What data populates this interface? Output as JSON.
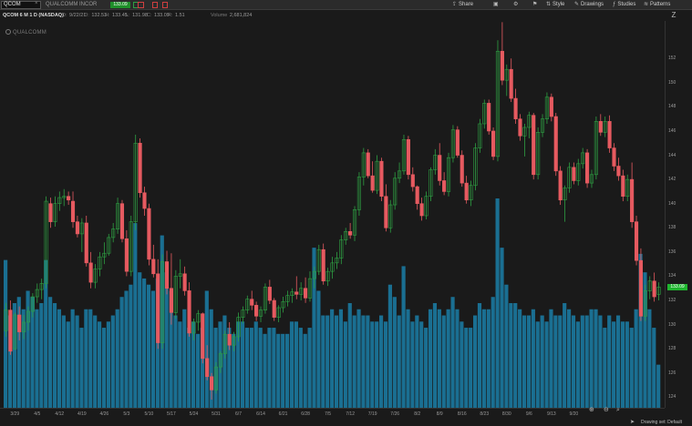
{
  "toolbar": {
    "symbol": "QCOM",
    "close_glyph": "×",
    "company": "QUALCOMM INCOR",
    "price": "133.09",
    "buttons": [
      {
        "label": "Share",
        "icon": "share-icon",
        "glyph": "⇪"
      },
      {
        "label": "",
        "icon": "layout-icon",
        "glyph": "▣"
      },
      {
        "label": "",
        "icon": "settings-icon",
        "glyph": "⚙"
      },
      {
        "label": "",
        "icon": "flag-icon",
        "glyph": "⚑"
      },
      {
        "label": "Style",
        "icon": "style-icon",
        "glyph": "⇅"
      },
      {
        "label": "Drawings",
        "icon": "drawings-icon",
        "glyph": "✎"
      },
      {
        "label": "Studies",
        "icon": "studies-icon",
        "glyph": "ƒ"
      },
      {
        "label": "Patterns",
        "icon": "patterns-icon",
        "glyph": "≋"
      }
    ]
  },
  "ohlc": {
    "title": "QCOM 6 M 1 D (NASDAQ)",
    "items": [
      {
        "k": "D:",
        "v": "9/22/21"
      },
      {
        "k": "O:",
        "v": "132.53"
      },
      {
        "k": "H:",
        "v": "133.45"
      },
      {
        "k": "L:",
        "v": "131.98"
      },
      {
        "k": "C:",
        "v": "133.09"
      },
      {
        "k": "R:",
        "v": "1.51"
      },
      {
        "k": "Volume",
        "v": "2,681,824"
      }
    ]
  },
  "watermark": "QUALCOMM",
  "axis_icon": "Z",
  "status": "Drawing set: Default",
  "chart_data": {
    "type": "candlestick+volume",
    "y_min": 123,
    "y_max": 143,
    "y_ticks": [
      124,
      126,
      128,
      130,
      132,
      134,
      136,
      138,
      140,
      142,
      144,
      146,
      148,
      150,
      152
    ],
    "last_price": 133.09,
    "x_ticks": [
      "3/29",
      "4/5",
      "4/12",
      "4/19",
      "4/26",
      "5/3",
      "5/10",
      "5/17",
      "5/24",
      "5/31",
      "6/7",
      "6/14",
      "6/21",
      "6/28",
      "7/5",
      "7/12",
      "7/19",
      "7/26",
      "8/2",
      "8/9",
      "8/16",
      "8/23",
      "8/30",
      "9/6",
      "9/13",
      "9/20"
    ],
    "colors": {
      "up": "#2ea043",
      "down": "#e65a60",
      "volume": "#1a6f92"
    },
    "candles": [
      [
        129.5,
        131.8,
        129.0,
        131.2,
        2.4
      ],
      [
        131.2,
        132.0,
        127.5,
        127.8,
        1.5
      ],
      [
        128.0,
        131.0,
        127.9,
        130.8,
        1.7
      ],
      [
        130.8,
        131.5,
        128.7,
        129.4,
        1.8
      ],
      [
        129.4,
        130.8,
        128.8,
        130.2,
        1.6
      ],
      [
        130.2,
        131.5,
        129.5,
        131.1,
        1.9
      ],
      [
        131.1,
        132.6,
        130.6,
        132.3,
        1.8
      ],
      [
        132.3,
        133.4,
        131.8,
        132.9,
        1.6
      ],
      [
        132.9,
        133.8,
        132.1,
        133.4,
        1.7
      ],
      [
        133.4,
        140.6,
        133.0,
        140.2,
        2.4
      ],
      [
        140.0,
        140.5,
        138.0,
        138.5,
        1.8
      ],
      [
        138.5,
        140.6,
        138.1,
        140.0,
        1.7
      ],
      [
        140.0,
        141.0,
        139.4,
        140.5,
        1.6
      ],
      [
        140.5,
        141.2,
        139.8,
        140.6,
        1.5
      ],
      [
        140.6,
        141.0,
        139.9,
        140.3,
        1.4
      ],
      [
        140.2,
        141.0,
        138.0,
        138.5,
        1.6
      ],
      [
        138.5,
        139.0,
        137.2,
        137.5,
        1.5
      ],
      [
        137.5,
        138.8,
        136.0,
        138.4,
        1.3
      ],
      [
        138.4,
        139.0,
        134.8,
        135.1,
        1.6
      ],
      [
        135.1,
        136.0,
        133.0,
        133.5,
        1.6
      ],
      [
        133.5,
        135.0,
        133.0,
        134.6,
        1.5
      ],
      [
        134.6,
        136.0,
        134.0,
        135.6,
        1.4
      ],
      [
        135.6,
        136.8,
        135.0,
        135.9,
        1.3
      ],
      [
        135.9,
        137.5,
        135.7,
        137.2,
        1.4
      ],
      [
        137.2,
        138.4,
        136.8,
        137.9,
        1.5
      ],
      [
        137.9,
        140.5,
        137.5,
        140.0,
        1.6
      ],
      [
        140.0,
        140.3,
        136.8,
        137.1,
        1.8
      ],
      [
        137.1,
        137.8,
        134.0,
        134.4,
        1.9
      ],
      [
        134.4,
        139.0,
        134.0,
        138.5,
        2.0
      ],
      [
        138.5,
        145.7,
        137.8,
        145.0,
        3.0
      ],
      [
        145.0,
        145.4,
        140.5,
        140.9,
        2.2
      ],
      [
        140.9,
        141.4,
        139.0,
        139.6,
        2.1
      ],
      [
        139.6,
        140.0,
        134.9,
        135.4,
        2.0
      ],
      [
        135.4,
        136.6,
        133.9,
        134.2,
        1.9
      ],
      [
        134.2,
        135.4,
        128.0,
        128.5,
        2.1
      ],
      [
        128.5,
        135.8,
        128.0,
        135.2,
        2.8
      ],
      [
        135.2,
        136.1,
        132.5,
        133.0,
        2.2
      ],
      [
        133.0,
        135.9,
        130.0,
        131.0,
        1.9
      ],
      [
        131.0,
        134.5,
        130.5,
        134.0,
        1.5
      ],
      [
        134.0,
        135.4,
        133.0,
        134.2,
        1.4
      ],
      [
        134.2,
        134.8,
        132.4,
        132.8,
        1.6
      ],
      [
        132.8,
        133.5,
        129.0,
        129.3,
        1.3
      ],
      [
        129.3,
        130.5,
        128.7,
        130.2,
        1.4
      ],
      [
        130.2,
        131.2,
        129.5,
        130.9,
        1.2
      ],
      [
        130.9,
        131.0,
        126.8,
        127.2,
        1.3
      ],
      [
        127.2,
        128.3,
        125.4,
        125.7,
        1.9
      ],
      [
        125.7,
        126.0,
        123.8,
        124.6,
        1.6
      ],
      [
        124.6,
        126.9,
        124.3,
        126.5,
        1.3
      ],
      [
        126.5,
        127.8,
        126.0,
        127.6,
        1.4
      ],
      [
        127.6,
        129.5,
        127.2,
        129.2,
        1.5
      ],
      [
        129.2,
        130.2,
        127.9,
        128.3,
        1.3
      ],
      [
        128.3,
        129.4,
        127.8,
        129.0,
        1.2
      ],
      [
        129.0,
        131.0,
        128.6,
        130.6,
        1.4
      ],
      [
        130.6,
        131.5,
        130.1,
        131.2,
        1.4
      ],
      [
        131.2,
        132.4,
        130.9,
        132.1,
        1.3
      ],
      [
        132.1,
        132.8,
        131.2,
        131.6,
        1.3
      ],
      [
        131.6,
        131.9,
        130.3,
        130.7,
        1.4
      ],
      [
        130.7,
        131.5,
        130.2,
        131.2,
        1.3
      ],
      [
        131.2,
        133.4,
        130.9,
        133.1,
        1.2
      ],
      [
        133.1,
        133.7,
        131.7,
        132.0,
        1.3
      ],
      [
        132.0,
        132.2,
        130.3,
        130.6,
        1.3
      ],
      [
        130.6,
        131.6,
        130.2,
        131.4,
        1.2
      ],
      [
        131.4,
        132.3,
        131.0,
        131.9,
        1.2
      ],
      [
        131.9,
        132.8,
        131.5,
        132.4,
        1.2
      ],
      [
        132.4,
        133.0,
        131.8,
        132.7,
        1.4
      ],
      [
        132.7,
        134.0,
        132.1,
        132.5,
        1.4
      ],
      [
        132.5,
        133.5,
        132.0,
        133.0,
        1.3
      ],
      [
        133.0,
        133.9,
        131.8,
        132.2,
        1.2
      ],
      [
        132.2,
        134.4,
        131.9,
        133.8,
        1.3
      ],
      [
        133.8,
        134.8,
        133.0,
        134.4,
        2.6
      ],
      [
        134.4,
        136.6,
        134.1,
        136.2,
        1.9
      ],
      [
        136.2,
        136.7,
        133.3,
        133.6,
        1.5
      ],
      [
        133.6,
        134.7,
        133.2,
        134.4,
        1.5
      ],
      [
        134.4,
        135.6,
        133.8,
        135.1,
        1.6
      ],
      [
        135.1,
        136.0,
        134.6,
        135.5,
        1.5
      ],
      [
        135.5,
        137.4,
        135.0,
        137.0,
        1.6
      ],
      [
        137.0,
        138.0,
        136.6,
        137.7,
        1.4
      ],
      [
        137.7,
        138.4,
        137.1,
        137.4,
        1.7
      ],
      [
        137.4,
        139.8,
        136.9,
        139.5,
        1.5
      ],
      [
        139.5,
        142.6,
        139.0,
        142.2,
        1.6
      ],
      [
        142.2,
        144.6,
        141.5,
        144.2,
        1.5
      ],
      [
        144.2,
        144.5,
        142.1,
        142.3,
        1.5
      ],
      [
        142.3,
        143.5,
        140.9,
        141.1,
        1.4
      ],
      [
        141.1,
        144.0,
        140.8,
        143.5,
        1.4
      ],
      [
        143.5,
        143.8,
        140.2,
        140.6,
        1.5
      ],
      [
        140.6,
        141.6,
        137.7,
        138.0,
        1.4
      ],
      [
        138.0,
        140.3,
        137.6,
        139.9,
        2.0
      ],
      [
        139.9,
        142.6,
        139.5,
        142.1,
        1.8
      ],
      [
        142.1,
        143.4,
        141.7,
        142.7,
        1.5
      ],
      [
        142.7,
        145.7,
        142.4,
        145.3,
        2.3
      ],
      [
        145.3,
        145.6,
        142.0,
        142.4,
        1.6
      ],
      [
        142.4,
        143.0,
        141.0,
        141.4,
        1.4
      ],
      [
        141.4,
        141.5,
        139.5,
        140.0,
        1.5
      ],
      [
        140.0,
        140.5,
        138.6,
        139.0,
        1.4
      ],
      [
        139.0,
        141.0,
        138.7,
        140.6,
        1.3
      ],
      [
        140.6,
        143.0,
        140.2,
        142.8,
        1.6
      ],
      [
        142.8,
        144.5,
        142.4,
        144.0,
        1.7
      ],
      [
        144.0,
        145.0,
        141.5,
        141.9,
        1.6
      ],
      [
        141.9,
        142.6,
        140.7,
        141.0,
        1.5
      ],
      [
        141.0,
        144.2,
        140.6,
        143.8,
        1.6
      ],
      [
        143.8,
        146.5,
        143.4,
        146.1,
        1.8
      ],
      [
        146.1,
        146.4,
        143.8,
        144.0,
        1.6
      ],
      [
        144.0,
        144.4,
        141.4,
        141.7,
        1.4
      ],
      [
        141.7,
        142.3,
        140.0,
        140.3,
        1.3
      ],
      [
        140.3,
        141.9,
        139.8,
        141.5,
        1.3
      ],
      [
        141.5,
        145.0,
        141.1,
        144.6,
        1.5
      ],
      [
        144.6,
        147.0,
        144.2,
        146.6,
        1.7
      ],
      [
        146.6,
        148.6,
        146.2,
        148.3,
        1.6
      ],
      [
        148.3,
        148.6,
        145.7,
        146.0,
        1.6
      ],
      [
        146.0,
        146.3,
        143.6,
        143.9,
        1.8
      ],
      [
        143.9,
        153.5,
        143.5,
        152.6,
        3.4
      ],
      [
        152.6,
        155.0,
        149.8,
        150.2,
        2.6
      ],
      [
        150.2,
        151.5,
        148.9,
        151.1,
        2.0
      ],
      [
        151.1,
        152.0,
        148.4,
        148.7,
        1.7
      ],
      [
        148.7,
        149.5,
        146.6,
        147.0,
        1.7
      ],
      [
        147.0,
        147.4,
        145.2,
        145.6,
        1.6
      ],
      [
        145.6,
        146.6,
        143.9,
        146.3,
        1.5
      ],
      [
        146.3,
        147.6,
        145.4,
        147.3,
        1.5
      ],
      [
        147.3,
        147.5,
        142.0,
        142.4,
        1.6
      ],
      [
        142.4,
        146.3,
        142.0,
        145.9,
        1.4
      ],
      [
        145.9,
        147.4,
        145.5,
        147.0,
        1.5
      ],
      [
        147.0,
        149.2,
        146.6,
        148.8,
        1.4
      ],
      [
        148.8,
        149.1,
        146.8,
        147.2,
        1.6
      ],
      [
        147.2,
        147.5,
        142.3,
        142.7,
        1.5
      ],
      [
        142.7,
        143.1,
        139.9,
        140.3,
        1.5
      ],
      [
        140.3,
        141.5,
        138.5,
        141.3,
        1.7
      ],
      [
        141.3,
        143.4,
        140.9,
        143.0,
        1.6
      ],
      [
        143.0,
        143.4,
        141.6,
        141.9,
        1.5
      ],
      [
        141.9,
        143.7,
        141.5,
        143.3,
        1.4
      ],
      [
        143.3,
        144.6,
        142.9,
        144.2,
        1.5
      ],
      [
        144.2,
        144.5,
        141.3,
        141.7,
        1.5
      ],
      [
        141.7,
        142.8,
        141.3,
        142.4,
        1.6
      ],
      [
        142.4,
        147.2,
        142.0,
        146.8,
        1.6
      ],
      [
        146.8,
        147.4,
        145.6,
        145.9,
        1.5
      ],
      [
        145.9,
        147.2,
        145.5,
        146.8,
        1.3
      ],
      [
        146.8,
        147.3,
        144.2,
        144.6,
        1.5
      ],
      [
        144.6,
        145.0,
        142.7,
        143.1,
        1.4
      ],
      [
        143.1,
        143.8,
        141.9,
        142.3,
        1.5
      ],
      [
        142.3,
        142.8,
        140.2,
        140.6,
        1.4
      ],
      [
        140.6,
        142.4,
        140.2,
        142.0,
        1.4
      ],
      [
        142.0,
        143.4,
        138.0,
        138.5,
        1.3
      ],
      [
        138.5,
        139.0,
        134.9,
        135.3,
        1.6
      ],
      [
        135.3,
        136.3,
        130.3,
        130.7,
        2.5
      ],
      [
        130.7,
        133.3,
        130.3,
        132.8,
        2.2
      ],
      [
        132.8,
        134.0,
        132.1,
        133.6,
        1.6
      ],
      [
        133.6,
        134.3,
        131.9,
        132.3,
        1.3
      ],
      [
        132.5,
        133.5,
        132.0,
        133.1,
        0.7
      ]
    ]
  }
}
